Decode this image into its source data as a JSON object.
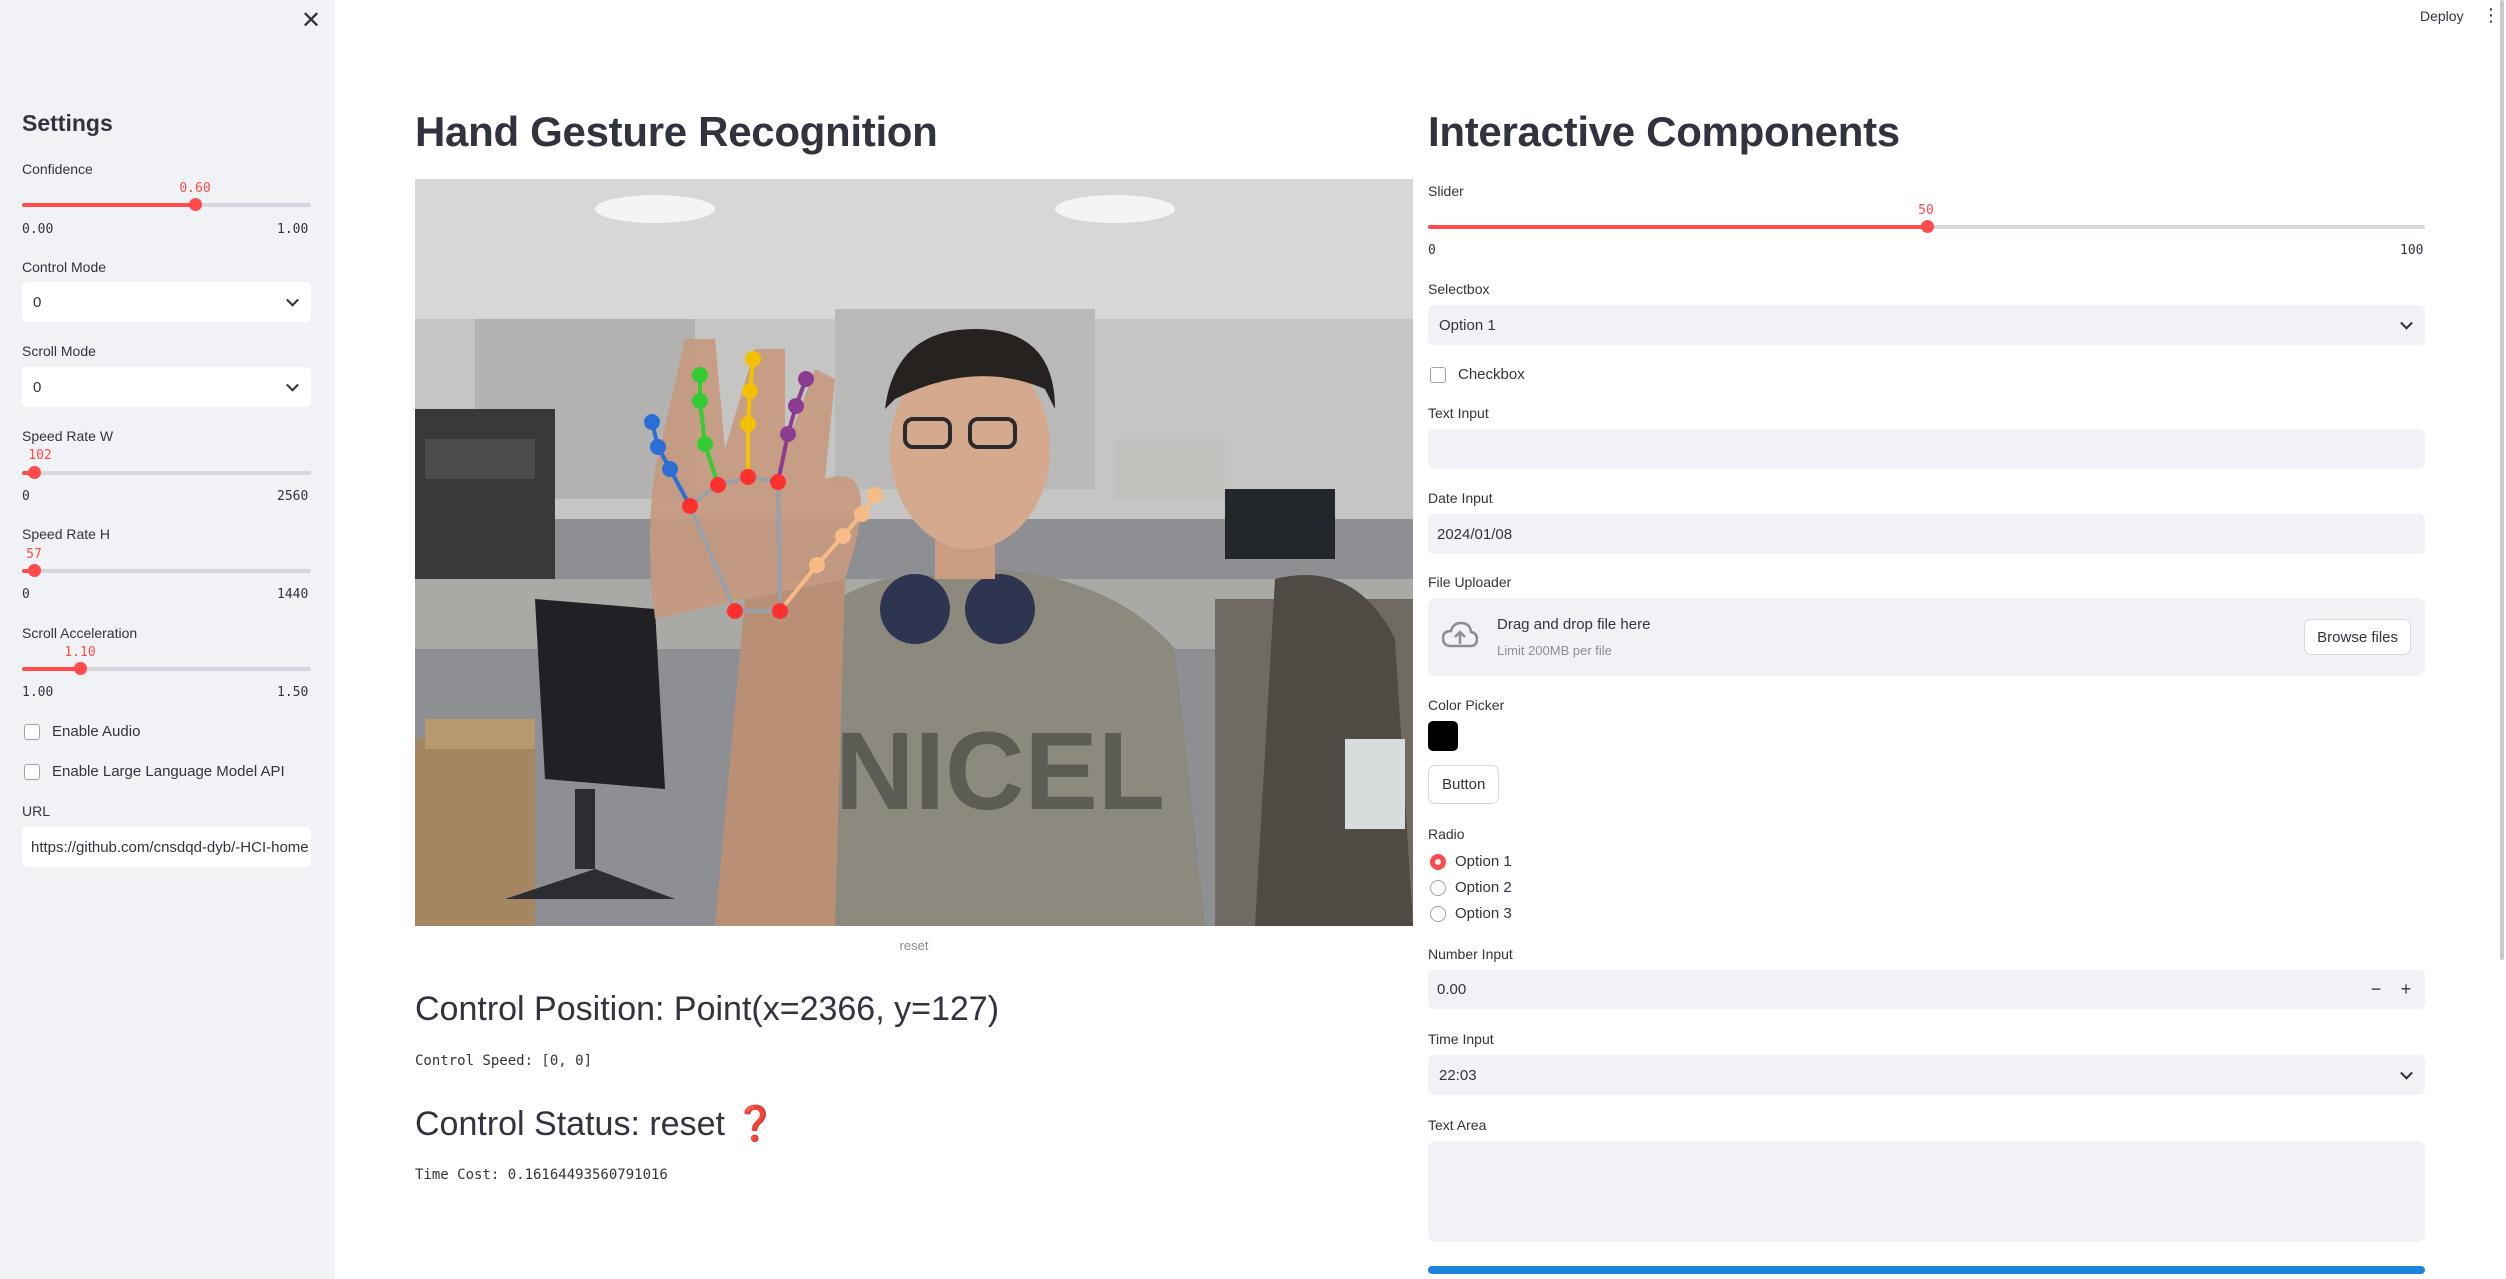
{
  "sidebar": {
    "close_icon": "close-icon",
    "title": "Settings",
    "confidence": {
      "label": "Confidence",
      "value": "0.60",
      "min": "0.00",
      "max": "1.00",
      "fraction": 0.6
    },
    "control_mode": {
      "label": "Control Mode",
      "value": "0"
    },
    "scroll_mode": {
      "label": "Scroll Mode",
      "value": "0"
    },
    "speed_rate_w": {
      "label": "Speed Rate W",
      "value": "102",
      "min": "0",
      "max": "2560",
      "fraction": 0.0398
    },
    "speed_rate_h": {
      "label": "Speed Rate H",
      "value": "57",
      "min": "0",
      "max": "1440",
      "fraction": 0.0396
    },
    "scroll_acceleration": {
      "label": "Scroll Acceleration",
      "value": "1.10",
      "min": "1.00",
      "max": "1.50",
      "fraction": 0.2
    },
    "enable_audio": "Enable Audio",
    "enable_llm": "Enable Large Language Model API",
    "url": {
      "label": "URL",
      "value": "https://github.com/cnsdqd-dyb/-HCI-home"
    }
  },
  "header": {
    "deploy": "Deploy",
    "menu_icon": "kebab-menu-icon"
  },
  "main": {
    "title": "Hand Gesture Recognition",
    "video_caption": "reset",
    "control_position": "Control Position: Point(x=2366, y=127)",
    "control_speed": "Control Speed: [0, 0]",
    "control_status": "Control Status: reset ❓",
    "time_cost": "Time Cost: 0.16164493560791016"
  },
  "components": {
    "title": "Interactive Components",
    "slider": {
      "label": "Slider",
      "value": "50",
      "min": "0",
      "max": "100",
      "fraction": 0.5
    },
    "selectbox": {
      "label": "Selectbox",
      "value": "Option 1"
    },
    "checkbox": "Checkbox",
    "text_input": {
      "label": "Text Input",
      "value": ""
    },
    "date_input": {
      "label": "Date Input",
      "value": "2024/01/08"
    },
    "file_uploader": {
      "label": "File Uploader",
      "drop_text": "Drag and drop file here",
      "limit": "Limit 200MB per file",
      "browse": "Browse files",
      "icon": "cloud-upload-icon"
    },
    "color_picker": {
      "label": "Color Picker",
      "color": "#000000"
    },
    "button": "Button",
    "radio": {
      "label": "Radio",
      "options": [
        "Option 1",
        "Option 2",
        "Option 3"
      ],
      "selected": 0
    },
    "number_input": {
      "label": "Number Input",
      "value": "0.00",
      "minus": "−",
      "plus": "+"
    },
    "time_input": {
      "label": "Time Input",
      "value": "22:03"
    },
    "text_area": {
      "label": "Text Area",
      "value": ""
    }
  },
  "colors": {
    "accent": "#ff4b4b",
    "sidebar_bg": "#f0f2f6",
    "progress": "#1c83e1"
  }
}
